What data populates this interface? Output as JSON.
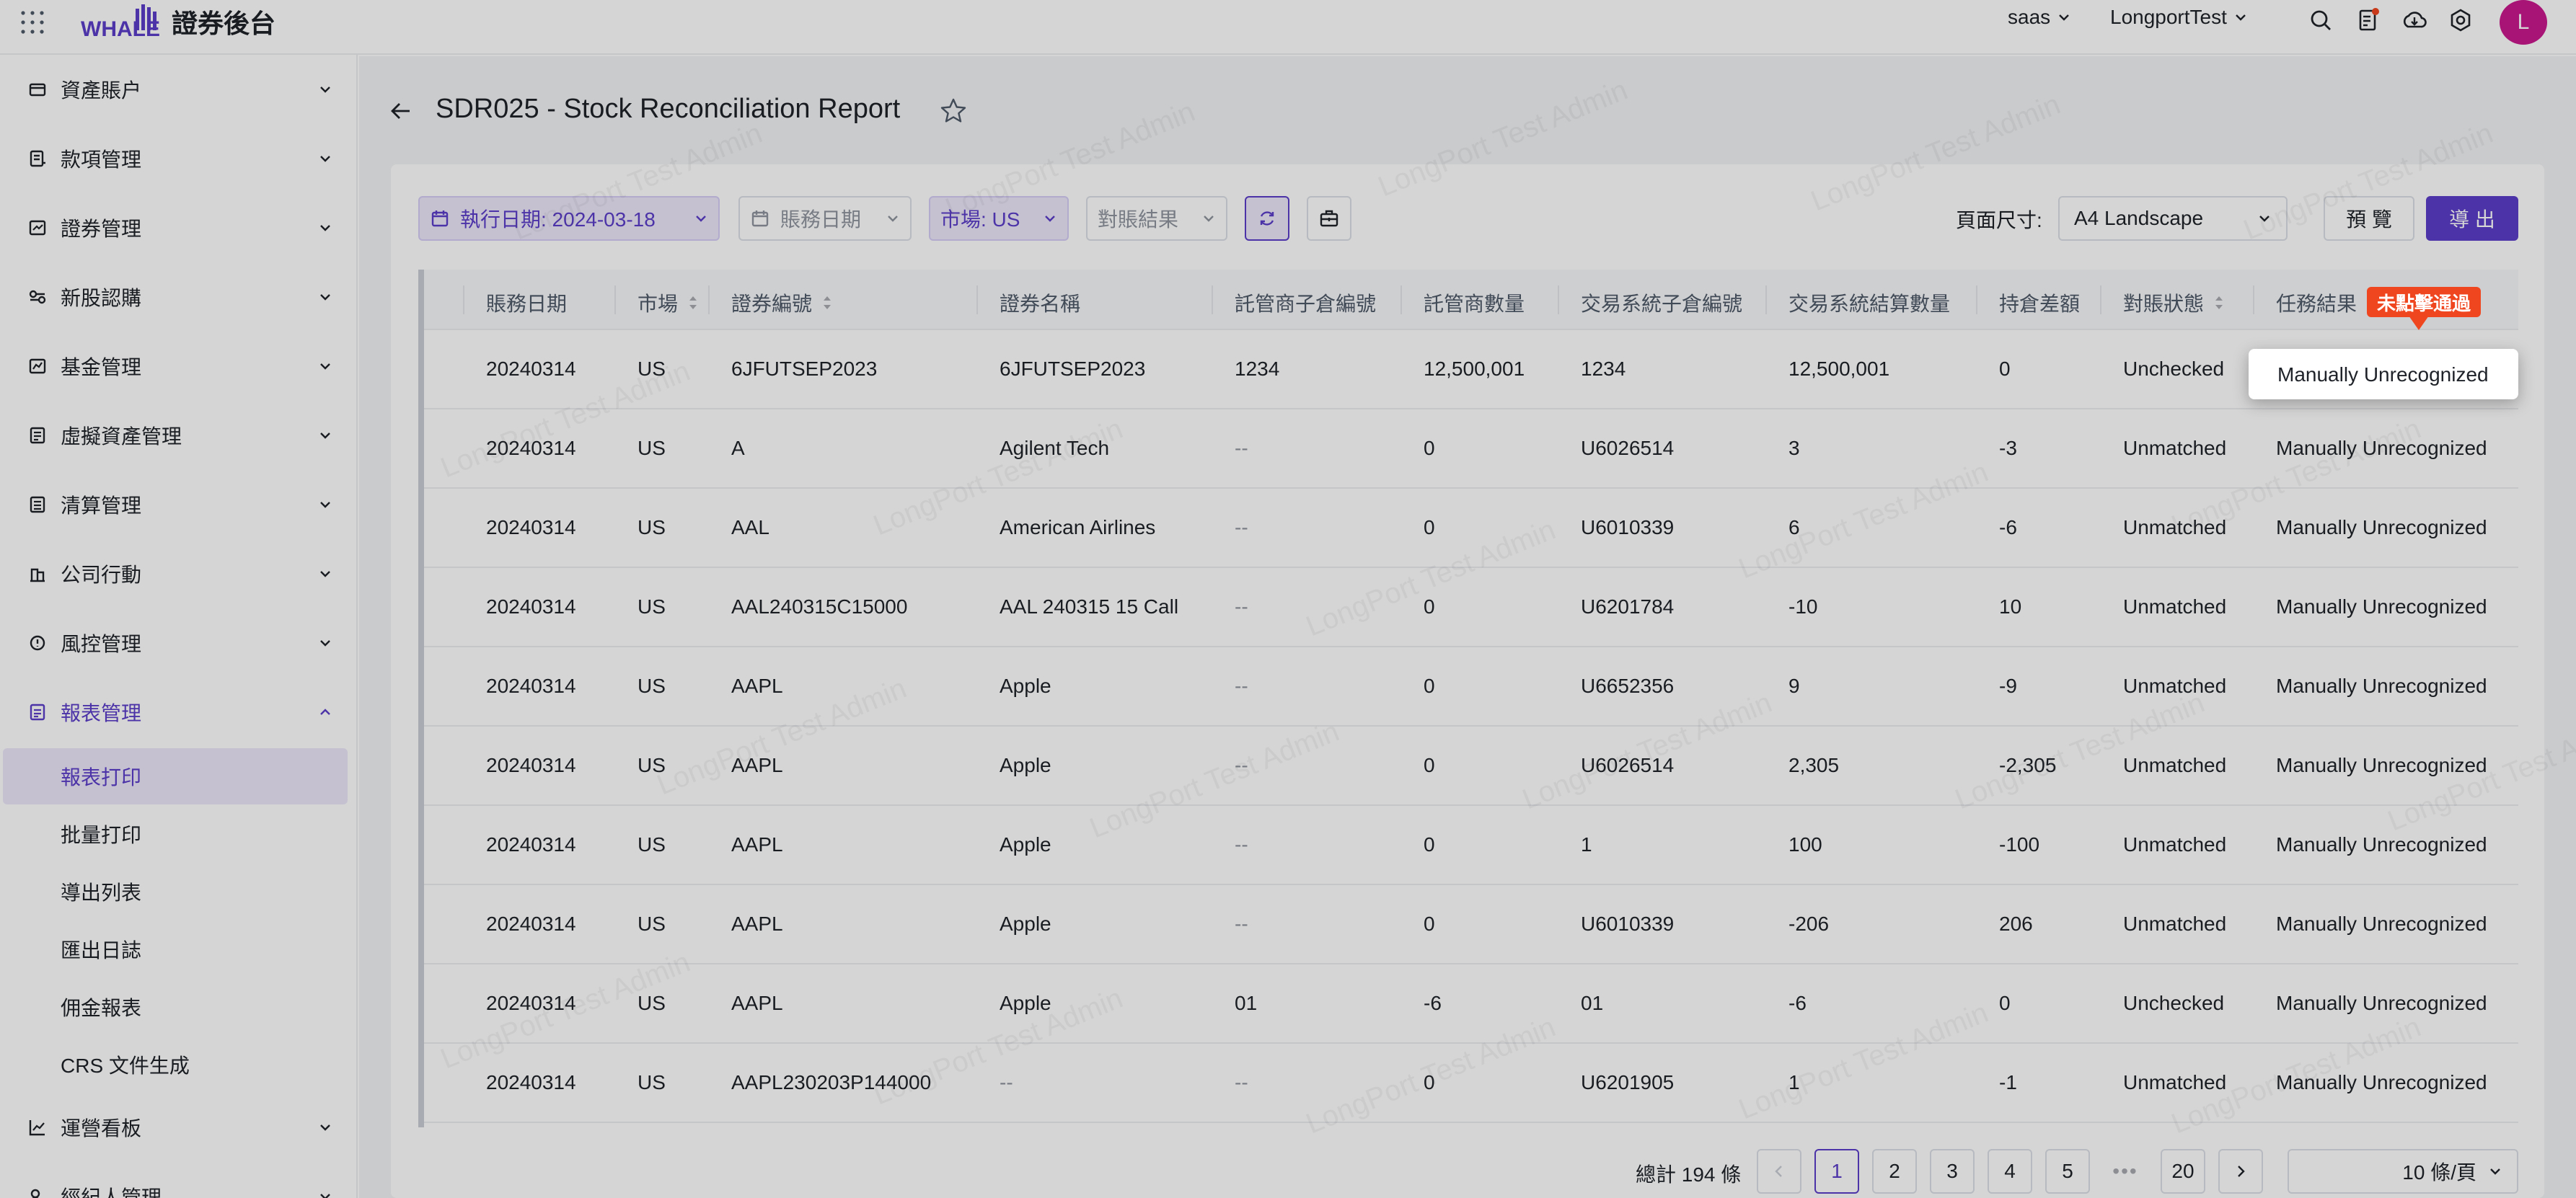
{
  "app": {
    "logo_text": "WHALE",
    "title": "證券後台",
    "tenant": "saas",
    "org": "LongportTest",
    "avatar_initial": "L",
    "watermark": "LongPort Test Admin"
  },
  "sidebar": {
    "items": [
      {
        "label": "資產賬户",
        "icon": "wallet-icon",
        "expanded": false
      },
      {
        "label": "款項管理",
        "icon": "ledger-icon",
        "expanded": false
      },
      {
        "label": "證券管理",
        "icon": "chart-box-icon",
        "expanded": false
      },
      {
        "label": "新股認購",
        "icon": "ipo-icon",
        "expanded": false
      },
      {
        "label": "基金管理",
        "icon": "fund-icon",
        "expanded": false
      },
      {
        "label": "虛擬資產管理",
        "icon": "virtual-asset-icon",
        "expanded": false
      },
      {
        "label": "清算管理",
        "icon": "clearing-icon",
        "expanded": false
      },
      {
        "label": "公司行動",
        "icon": "corporate-action-icon",
        "expanded": false
      },
      {
        "label": "風控管理",
        "icon": "risk-icon",
        "expanded": false
      },
      {
        "label": "報表管理",
        "icon": "report-icon",
        "expanded": true
      },
      {
        "label": "運營看板",
        "icon": "dashboard-icon",
        "expanded": false
      },
      {
        "label": "經紀人管理",
        "icon": "broker-icon",
        "expanded": false
      }
    ],
    "subitems": [
      {
        "label": "報表打印",
        "selected": true
      },
      {
        "label": "批量打印",
        "selected": false
      },
      {
        "label": "導出列表",
        "selected": false
      },
      {
        "label": "匯出日誌",
        "selected": false
      },
      {
        "label": "佣金報表",
        "selected": false
      },
      {
        "label": "CRS 文件生成",
        "selected": false
      }
    ]
  },
  "page": {
    "title": "SDR025 - Stock Reconciliation Report"
  },
  "filters": {
    "exec_date": "執行日期: 2024-03-18",
    "account_date_placeholder": "賬務日期",
    "market": "市場: US",
    "recon_result_placeholder": "對賬結果",
    "page_size_label": "頁面尺寸:",
    "page_size_value": "A4 Landscape",
    "preview": "預 覽",
    "export": "導 出"
  },
  "table": {
    "columns": [
      ")",
      "賬務日期",
      "市場",
      "證券編號",
      "證券名稱",
      "託管商子倉編號",
      "託管商數量",
      "交易系統子倉編號",
      "交易系統結算數量",
      "持倉差額",
      "對賬狀態",
      "任務結果"
    ],
    "rows": [
      [
        "20240314",
        "US",
        "6JFUTSEP2023",
        "6JFUTSEP2023",
        "1234",
        "12,500,001",
        "1234",
        "12,500,001",
        "0",
        "Unchecked",
        "Manually Unrecognized"
      ],
      [
        "20240314",
        "US",
        "A",
        "Agilent Tech",
        "--",
        "0",
        "U6026514",
        "3",
        "-3",
        "Unmatched",
        "Manually Unrecognized"
      ],
      [
        "20240314",
        "US",
        "AAL",
        "American Airlines",
        "--",
        "0",
        "U6010339",
        "6",
        "-6",
        "Unmatched",
        "Manually Unrecognized"
      ],
      [
        "20240314",
        "US",
        "AAL240315C15000",
        "AAL 240315 15 Call",
        "--",
        "0",
        "U6201784",
        "-10",
        "10",
        "Unmatched",
        "Manually Unrecognized"
      ],
      [
        "20240314",
        "US",
        "AAPL",
        "Apple",
        "--",
        "0",
        "U6652356",
        "9",
        "-9",
        "Unmatched",
        "Manually Unrecognized"
      ],
      [
        "20240314",
        "US",
        "AAPL",
        "Apple",
        "--",
        "0",
        "U6026514",
        "2,305",
        "-2,305",
        "Unmatched",
        "Manually Unrecognized"
      ],
      [
        "20240314",
        "US",
        "AAPL",
        "Apple",
        "--",
        "0",
        "1",
        "100",
        "-100",
        "Unmatched",
        "Manually Unrecognized"
      ],
      [
        "20240314",
        "US",
        "AAPL",
        "Apple",
        "--",
        "0",
        "U6010339",
        "-206",
        "206",
        "Unmatched",
        "Manually Unrecognized"
      ],
      [
        "20240314",
        "US",
        "AAPL",
        "Apple",
        "01",
        "-6",
        "01",
        "-6",
        "0",
        "Unchecked",
        "Manually Unrecognized"
      ],
      [
        "20240314",
        "US",
        "AAPL230203P144000",
        "--",
        "--",
        "0",
        "U6201905",
        "1",
        "-1",
        "Unmatched",
        "Manually Unrecognized"
      ]
    ],
    "highlight_tag": "未點擊通過"
  },
  "pagination": {
    "total": "總計 194 條",
    "pages": [
      "1",
      "2",
      "3",
      "4",
      "5",
      "•••",
      "20"
    ],
    "current": "1",
    "page_size": "10 條/頁"
  },
  "colors": {
    "accent": "#5b3ec8",
    "accent_light": "#ece8fb",
    "tag_red": "#f0461f",
    "avatar": "#c8198c"
  }
}
